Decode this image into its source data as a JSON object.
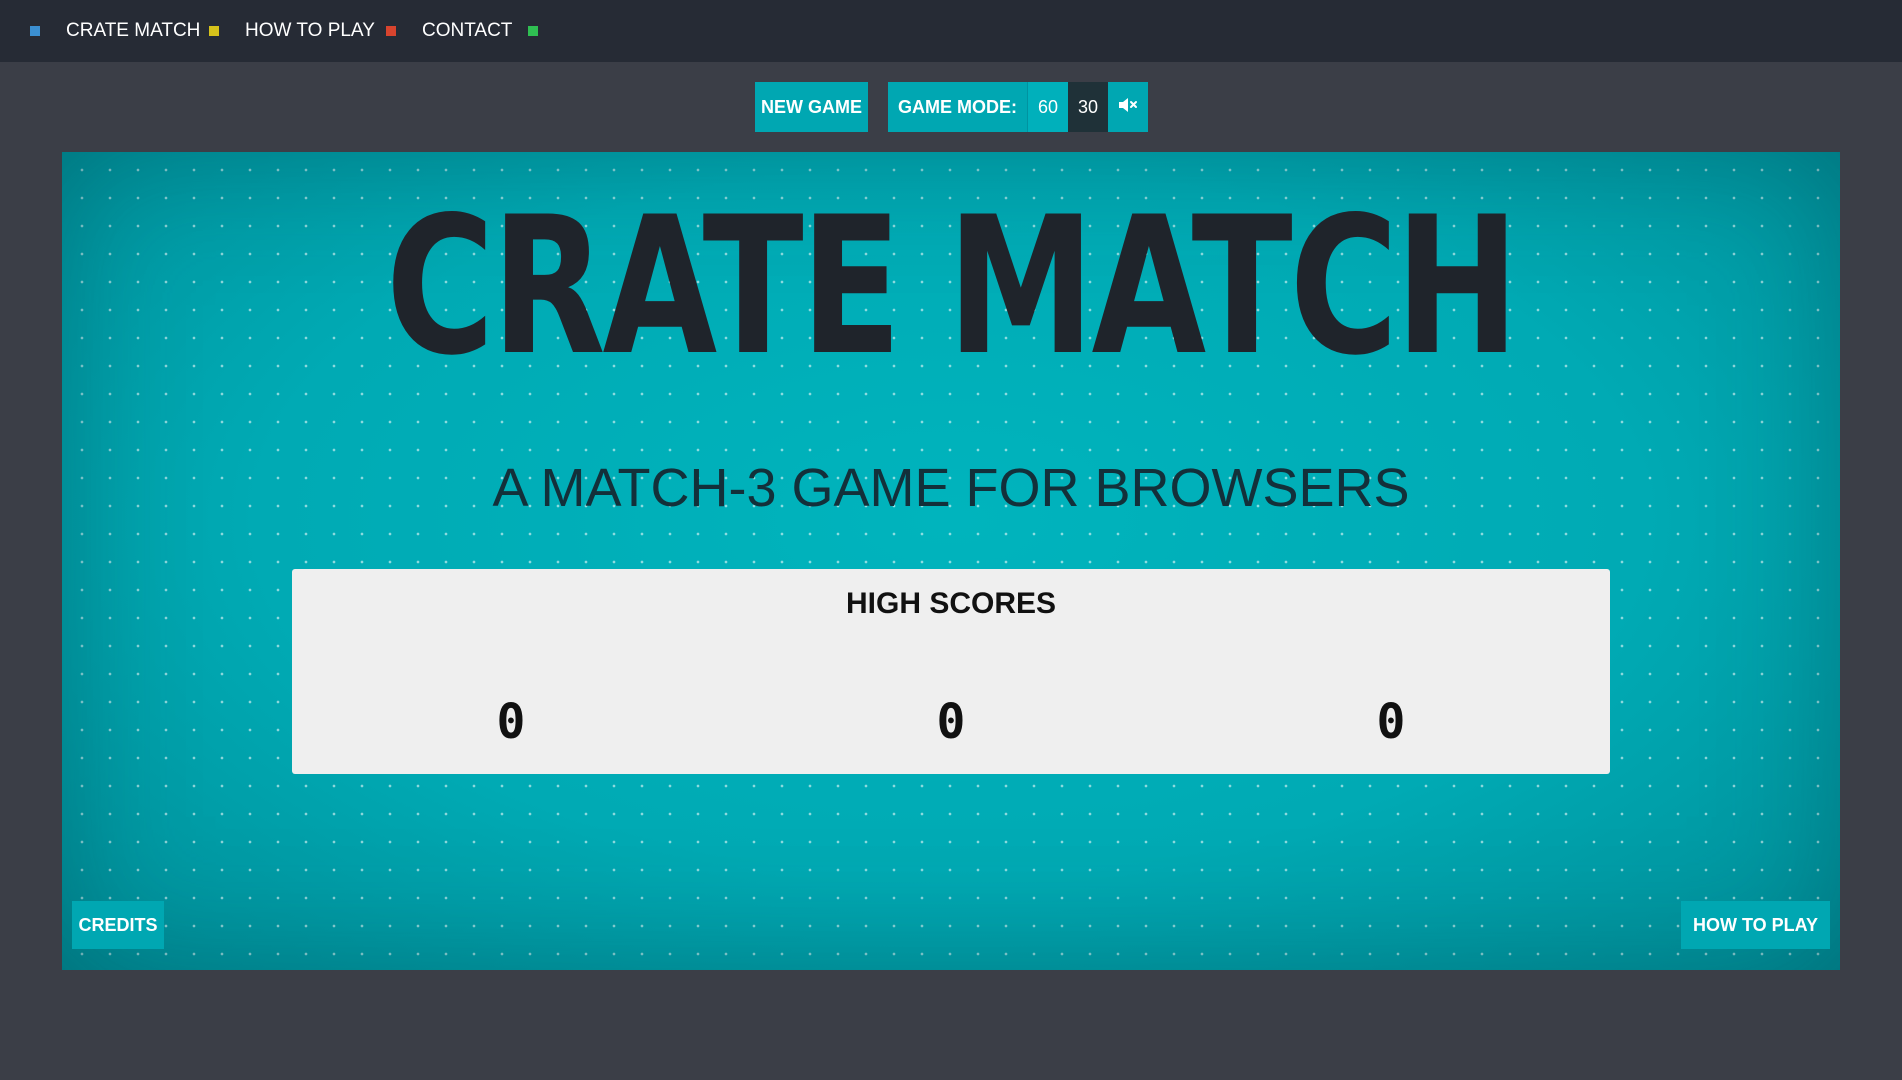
{
  "nav": {
    "items": [
      {
        "label": "CRATE MATCH",
        "dot_color": "#3b8fd1"
      },
      {
        "label": "HOW TO PLAY",
        "dot_color": "#d6c21b"
      },
      {
        "label": "CONTACT",
        "dot_color": "#d8442e"
      }
    ],
    "trailing_dot_color": "#2fbf52"
  },
  "toolbar": {
    "new_game_label": "NEW GAME",
    "game_mode_label": "GAME MODE:",
    "mode_options": [
      "60",
      "30"
    ],
    "selected_mode": "60",
    "mute_icon": "speaker-muted-icon"
  },
  "game": {
    "title": "CRATE MATCH",
    "subtitle": "A MATCH-3 GAME FOR BROWSERS",
    "high_scores": {
      "title": "HIGH SCORES",
      "values": [
        "0",
        "0",
        "0"
      ]
    },
    "credits_label": "CREDITS",
    "how_to_play_label": "HOW TO PLAY"
  },
  "colors": {
    "accent": "#00a7b2",
    "nav_bg": "#262b35",
    "page_bg": "#3b3e47",
    "title_text": "#1f242b"
  }
}
